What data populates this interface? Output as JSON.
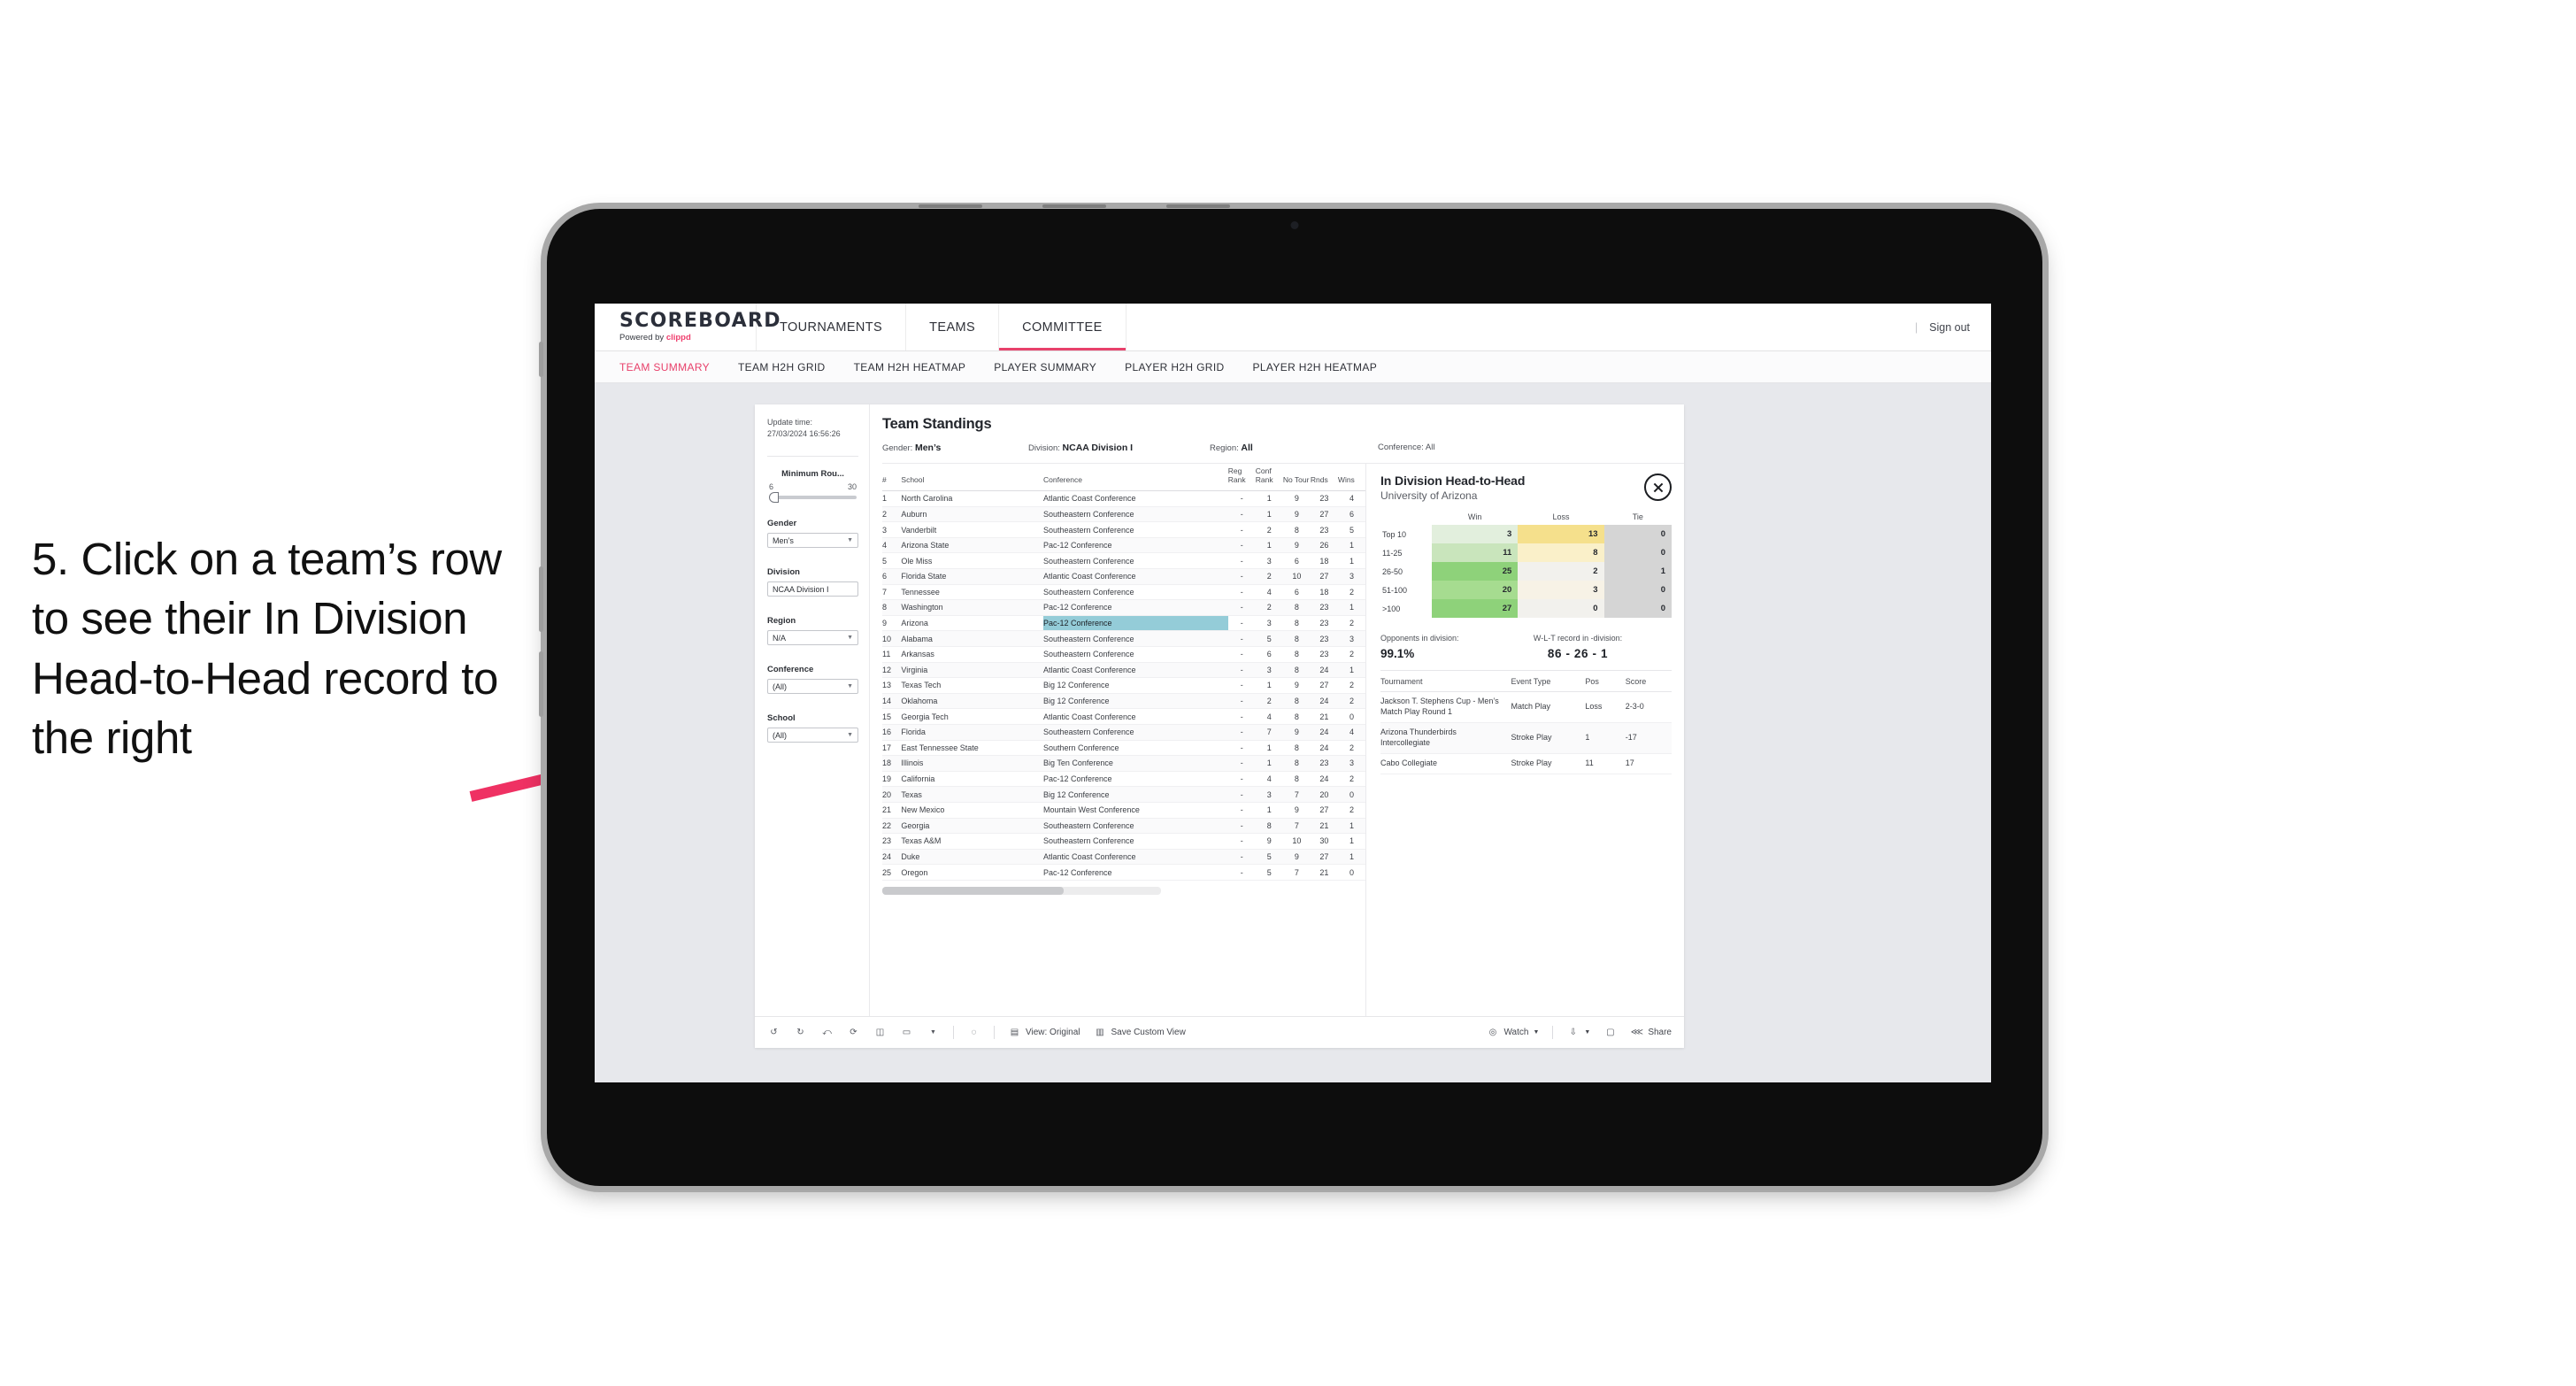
{
  "callout": {
    "text": "5. Click on a team’s row to see their In Division Head-to-Head record to the right"
  },
  "app": {
    "brand": {
      "name": "SCOREBOARD",
      "powered_prefix": "Powered by ",
      "powered_brand": "clippd"
    },
    "nav": [
      {
        "label": "TOURNAMENTS",
        "active": false
      },
      {
        "label": "TEAMS",
        "active": false
      },
      {
        "label": "COMMITTEE",
        "active": true
      }
    ],
    "nav_right": {
      "divider": "|",
      "sign_out": "Sign out"
    },
    "subnav": [
      {
        "label": "TEAM SUMMARY",
        "active": true
      },
      {
        "label": "TEAM H2H GRID",
        "active": false
      },
      {
        "label": "TEAM H2H HEATMAP",
        "active": false
      },
      {
        "label": "PLAYER SUMMARY",
        "active": false
      },
      {
        "label": "PLAYER H2H GRID",
        "active": false
      },
      {
        "label": "PLAYER H2H HEATMAP",
        "active": false
      }
    ]
  },
  "rail": {
    "update_label": "Update time:",
    "update_value": "27/03/2024 16:56:26",
    "slider": {
      "title": "Minimum Rou...",
      "min": "6",
      "max": "30"
    },
    "filters": [
      {
        "label": "Gender",
        "value": "Men’s"
      },
      {
        "label": "Division",
        "value": "NCAA Division I"
      },
      {
        "label": "Region",
        "value": "N/A"
      },
      {
        "label": "Conference",
        "value": "(All)"
      },
      {
        "label": "School",
        "value": "(All)"
      }
    ]
  },
  "standings": {
    "title": "Team Standings",
    "filters": [
      {
        "key": "Gender:",
        "value": "Men’s"
      },
      {
        "key": "Division:",
        "value": "NCAA Division I"
      },
      {
        "key": "Region:",
        "value": "All"
      },
      {
        "key": "Conference:",
        "value": "All"
      }
    ],
    "columns": [
      "#",
      "School",
      "Conference",
      "Reg Rank",
      "Conf Rank",
      "No Tour",
      "Rnds",
      "Wins"
    ],
    "rows": [
      {
        "rank": "1",
        "school": "North Carolina",
        "conf": "Atlantic Coast Conference",
        "reg": "-",
        "confrank": "1",
        "notour": "9",
        "rnds": "23",
        "wins": "4",
        "hl": false
      },
      {
        "rank": "2",
        "school": "Auburn",
        "conf": "Southeastern Conference",
        "reg": "-",
        "confrank": "1",
        "notour": "9",
        "rnds": "27",
        "wins": "6",
        "hl": false
      },
      {
        "rank": "3",
        "school": "Vanderbilt",
        "conf": "Southeastern Conference",
        "reg": "-",
        "confrank": "2",
        "notour": "8",
        "rnds": "23",
        "wins": "5",
        "hl": false
      },
      {
        "rank": "4",
        "school": "Arizona State",
        "conf": "Pac-12 Conference",
        "reg": "-",
        "confrank": "1",
        "notour": "9",
        "rnds": "26",
        "wins": "1",
        "hl": false
      },
      {
        "rank": "5",
        "school": "Ole Miss",
        "conf": "Southeastern Conference",
        "reg": "-",
        "confrank": "3",
        "notour": "6",
        "rnds": "18",
        "wins": "1",
        "hl": false
      },
      {
        "rank": "6",
        "school": "Florida State",
        "conf": "Atlantic Coast Conference",
        "reg": "-",
        "confrank": "2",
        "notour": "10",
        "rnds": "27",
        "wins": "3",
        "hl": false
      },
      {
        "rank": "7",
        "school": "Tennessee",
        "conf": "Southeastern Conference",
        "reg": "-",
        "confrank": "4",
        "notour": "6",
        "rnds": "18",
        "wins": "2",
        "hl": false
      },
      {
        "rank": "8",
        "school": "Washington",
        "conf": "Pac-12 Conference",
        "reg": "-",
        "confrank": "2",
        "notour": "8",
        "rnds": "23",
        "wins": "1",
        "hl": false
      },
      {
        "rank": "9",
        "school": "Arizona",
        "conf": "Pac-12 Conference",
        "reg": "-",
        "confrank": "3",
        "notour": "8",
        "rnds": "23",
        "wins": "2",
        "hl": true
      },
      {
        "rank": "10",
        "school": "Alabama",
        "conf": "Southeastern Conference",
        "reg": "-",
        "confrank": "5",
        "notour": "8",
        "rnds": "23",
        "wins": "3",
        "hl": false
      },
      {
        "rank": "11",
        "school": "Arkansas",
        "conf": "Southeastern Conference",
        "reg": "-",
        "confrank": "6",
        "notour": "8",
        "rnds": "23",
        "wins": "2",
        "hl": false
      },
      {
        "rank": "12",
        "school": "Virginia",
        "conf": "Atlantic Coast Conference",
        "reg": "-",
        "confrank": "3",
        "notour": "8",
        "rnds": "24",
        "wins": "1",
        "hl": false
      },
      {
        "rank": "13",
        "school": "Texas Tech",
        "conf": "Big 12 Conference",
        "reg": "-",
        "confrank": "1",
        "notour": "9",
        "rnds": "27",
        "wins": "2",
        "hl": false
      },
      {
        "rank": "14",
        "school": "Oklahoma",
        "conf": "Big 12 Conference",
        "reg": "-",
        "confrank": "2",
        "notour": "8",
        "rnds": "24",
        "wins": "2",
        "hl": false
      },
      {
        "rank": "15",
        "school": "Georgia Tech",
        "conf": "Atlantic Coast Conference",
        "reg": "-",
        "confrank": "4",
        "notour": "8",
        "rnds": "21",
        "wins": "0",
        "hl": false
      },
      {
        "rank": "16",
        "school": "Florida",
        "conf": "Southeastern Conference",
        "reg": "-",
        "confrank": "7",
        "notour": "9",
        "rnds": "24",
        "wins": "4",
        "hl": false
      },
      {
        "rank": "17",
        "school": "East Tennessee State",
        "conf": "Southern Conference",
        "reg": "-",
        "confrank": "1",
        "notour": "8",
        "rnds": "24",
        "wins": "2",
        "hl": false
      },
      {
        "rank": "18",
        "school": "Illinois",
        "conf": "Big Ten Conference",
        "reg": "-",
        "confrank": "1",
        "notour": "8",
        "rnds": "23",
        "wins": "3",
        "hl": false
      },
      {
        "rank": "19",
        "school": "California",
        "conf": "Pac-12 Conference",
        "reg": "-",
        "confrank": "4",
        "notour": "8",
        "rnds": "24",
        "wins": "2",
        "hl": false
      },
      {
        "rank": "20",
        "school": "Texas",
        "conf": "Big 12 Conference",
        "reg": "-",
        "confrank": "3",
        "notour": "7",
        "rnds": "20",
        "wins": "0",
        "hl": false
      },
      {
        "rank": "21",
        "school": "New Mexico",
        "conf": "Mountain West Conference",
        "reg": "-",
        "confrank": "1",
        "notour": "9",
        "rnds": "27",
        "wins": "2",
        "hl": false
      },
      {
        "rank": "22",
        "school": "Georgia",
        "conf": "Southeastern Conference",
        "reg": "-",
        "confrank": "8",
        "notour": "7",
        "rnds": "21",
        "wins": "1",
        "hl": false
      },
      {
        "rank": "23",
        "school": "Texas A&M",
        "conf": "Southeastern Conference",
        "reg": "-",
        "confrank": "9",
        "notour": "10",
        "rnds": "30",
        "wins": "1",
        "hl": false
      },
      {
        "rank": "24",
        "school": "Duke",
        "conf": "Atlantic Coast Conference",
        "reg": "-",
        "confrank": "5",
        "notour": "9",
        "rnds": "27",
        "wins": "1",
        "hl": false
      },
      {
        "rank": "25",
        "school": "Oregon",
        "conf": "Pac-12 Conference",
        "reg": "-",
        "confrank": "5",
        "notour": "7",
        "rnds": "21",
        "wins": "0",
        "hl": false
      }
    ]
  },
  "h2h": {
    "title": "In Division Head-to-Head",
    "subtitle": "University of Arizona",
    "close_icon": "close-icon",
    "matrix_columns": [
      "",
      "Win",
      "Loss",
      "Tie"
    ],
    "matrix_rows": [
      {
        "label": "Top 10",
        "win": "3",
        "loss": "13",
        "tie": "0",
        "win_color": "#e2efdd",
        "loss_color": "#f5e08c",
        "tie_color": "#d5d5d5"
      },
      {
        "label": "11-25",
        "win": "11",
        "loss": "8",
        "tie": "0",
        "win_color": "#c9e5bc",
        "loss_color": "#faf0c9",
        "tie_color": "#d5d5d5"
      },
      {
        "label": "26-50",
        "win": "25",
        "loss": "2",
        "tie": "1",
        "win_color": "#8ed27a",
        "loss_color": "#f2f1ed",
        "tie_color": "#d5d5d5"
      },
      {
        "label": "51-100",
        "win": "20",
        "loss": "3",
        "tie": "0",
        "win_color": "#a6dc90",
        "loss_color": "#f7f2e6",
        "tie_color": "#d5d5d5"
      },
      {
        "label": ">100",
        "win": "27",
        "loss": "0",
        "tie": "0",
        "win_color": "#8ed27a",
        "loss_color": "#f2f1ed",
        "tie_color": "#d5d5d5"
      }
    ],
    "stats": [
      {
        "label": "Opponents in division:",
        "value": "99.1%"
      },
      {
        "label": "W-L-T record in -division:",
        "value": "86 - 26 - 1"
      }
    ],
    "tournament_columns": [
      "Tournament",
      "Event Type",
      "Pos",
      "Score"
    ],
    "tournaments": [
      {
        "name": "Jackson T. Stephens Cup - Men’s Match Play Round 1",
        "type": "Match Play",
        "pos": "Loss",
        "score": "2-3-0"
      },
      {
        "name": "Arizona Thunderbirds Intercollegiate",
        "type": "Stroke Play",
        "pos": "1",
        "score": "-17"
      },
      {
        "name": "Cabo Collegiate",
        "type": "Stroke Play",
        "pos": "11",
        "score": "17"
      }
    ]
  },
  "toolbar": {
    "icons": [
      "undo-icon",
      "redo-icon",
      "revert-icon",
      "refresh-data-icon",
      "pause-icon",
      "rectangle-select-icon",
      "chevron-down-icon",
      "presentation-icon"
    ],
    "view_label": "View: Original",
    "save_label": "Save Custom View",
    "watch_label": "Watch",
    "share_label": "Share",
    "download_icon": "download-icon",
    "device-icon": "device-preview-icon",
    "share_icon": "share-icon"
  },
  "colors": {
    "accent": "#e8416b",
    "highlight_row": "#94ccd8",
    "app_bg": "#e7e8ec",
    "device_bezel": "#0d0d0d"
  }
}
